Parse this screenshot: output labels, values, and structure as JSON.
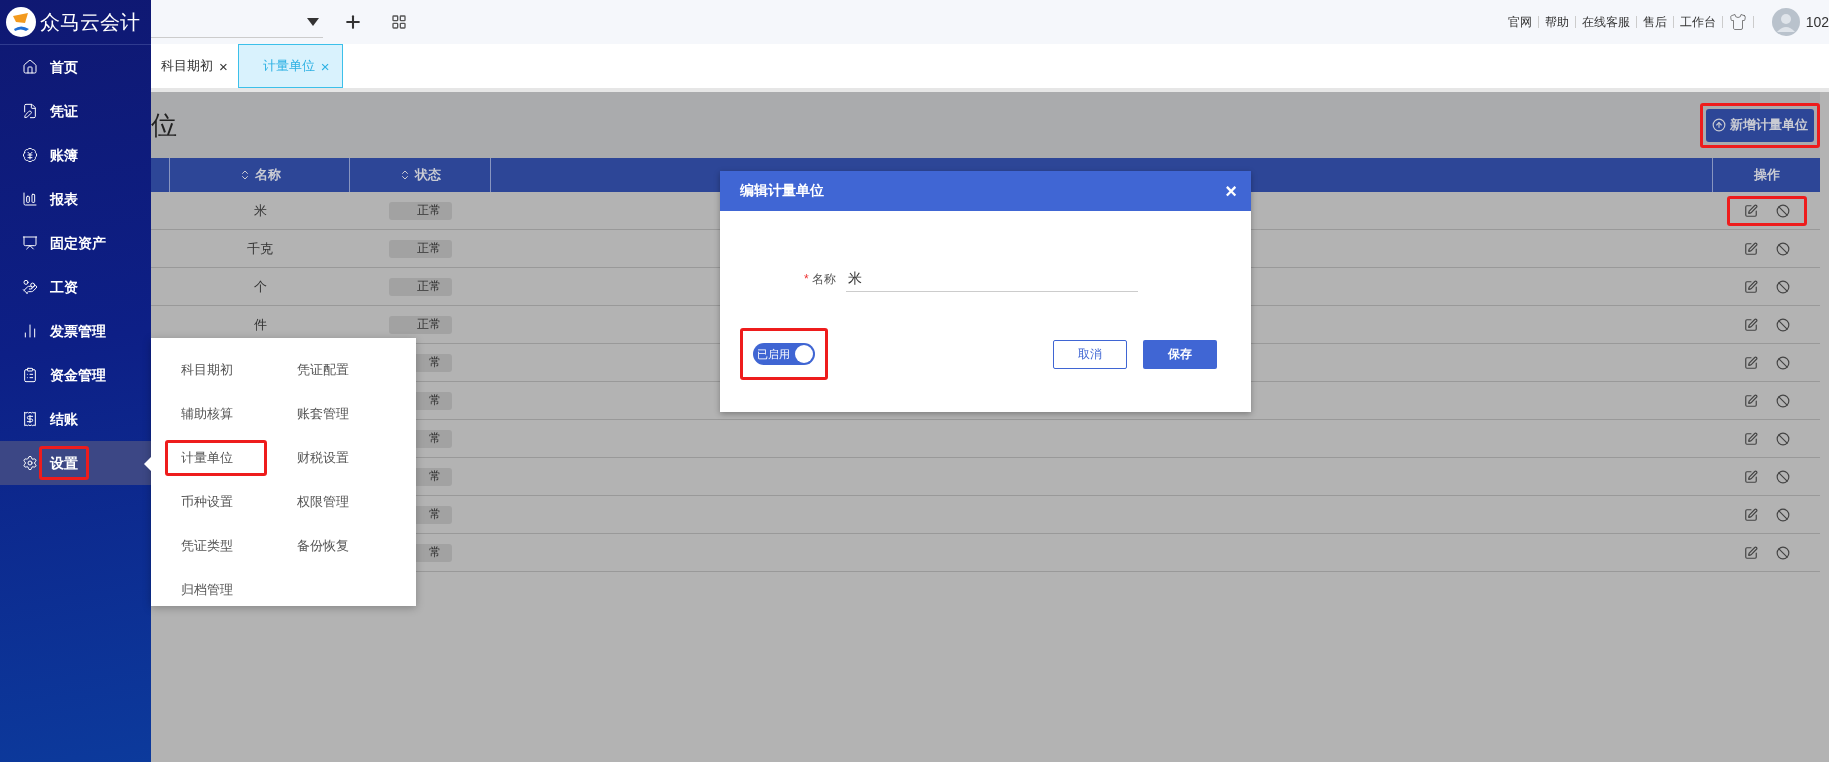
{
  "brand": {
    "name": "众马云会计"
  },
  "sidebar": {
    "items": [
      {
        "label": "首页",
        "selected": false,
        "highlighted": false
      },
      {
        "label": "凭证",
        "selected": false,
        "highlighted": false
      },
      {
        "label": "账簿",
        "selected": false,
        "highlighted": false
      },
      {
        "label": "报表",
        "selected": false,
        "highlighted": false
      },
      {
        "label": "固定资产",
        "selected": false,
        "highlighted": false
      },
      {
        "label": "工资",
        "selected": false,
        "highlighted": false
      },
      {
        "label": "发票管理",
        "selected": false,
        "highlighted": false
      },
      {
        "label": "资金管理",
        "selected": false,
        "highlighted": false
      },
      {
        "label": "结账",
        "selected": false,
        "highlighted": false
      },
      {
        "label": "设置",
        "selected": true,
        "highlighted": true
      }
    ]
  },
  "top_bar": {
    "links": [
      "官网",
      "帮助",
      "在线客服",
      "售后",
      "工作台"
    ],
    "user": "102"
  },
  "tabs": [
    {
      "label": "科目期初",
      "selected": false,
      "close": "×"
    },
    {
      "label": "计量单位",
      "selected": true,
      "close": "×"
    }
  ],
  "page": {
    "title": "位",
    "add_button": {
      "label": "新增计量单位",
      "highlighted": true
    }
  },
  "table": {
    "columns": [
      {
        "label": "名称",
        "sortable": true
      },
      {
        "label": "状态",
        "sortable": true
      },
      {
        "label": "操作",
        "sortable": false
      }
    ],
    "rows": [
      {
        "name": "米",
        "status": "正常",
        "highlighted": true
      },
      {
        "name": "千克",
        "status": "正常",
        "highlighted": false
      },
      {
        "name": "个",
        "status": "正常",
        "highlighted": false
      },
      {
        "name": "件",
        "status": "正常",
        "highlighted": false
      },
      {
        "status": "常",
        "highlighted": false
      },
      {
        "status": "常",
        "highlighted": false
      },
      {
        "status": "常",
        "highlighted": false
      },
      {
        "status": "常",
        "highlighted": false
      },
      {
        "status": "常",
        "highlighted": false
      },
      {
        "status": "常",
        "highlighted": false
      }
    ]
  },
  "settings_menu": {
    "items": [
      {
        "label": "科目期初",
        "highlighted": false
      },
      {
        "label": "凭证配置",
        "highlighted": false
      },
      {
        "label": "辅助核算",
        "highlighted": false
      },
      {
        "label": "账套管理",
        "highlighted": false
      },
      {
        "label": "计量单位",
        "highlighted": true
      },
      {
        "label": "财税设置",
        "highlighted": false
      },
      {
        "label": "币种设置",
        "highlighted": false
      },
      {
        "label": "权限管理",
        "highlighted": false
      },
      {
        "label": "凭证类型",
        "highlighted": false
      },
      {
        "label": "备份恢复",
        "highlighted": false
      },
      {
        "label": "归档管理",
        "highlighted": false
      }
    ]
  },
  "dialog": {
    "title": "编辑计量单位",
    "close": "×",
    "field": {
      "label": "名称",
      "required_mark": "*",
      "value": "米"
    },
    "toggle": {
      "label": "已启用",
      "on": true,
      "highlighted": true
    },
    "buttons": [
      {
        "label": "取消",
        "kind": "secondary"
      },
      {
        "label": "保存",
        "kind": "primary"
      }
    ]
  }
}
